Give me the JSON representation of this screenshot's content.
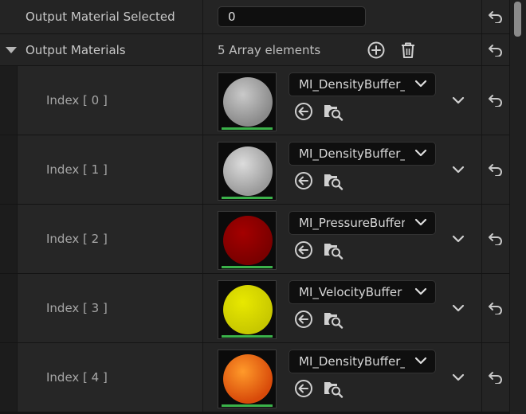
{
  "header": {
    "output_selected_label": "Output Material Selected",
    "output_selected_value": "0",
    "output_materials_label": "Output Materials",
    "array_count_text": "5 Array elements"
  },
  "elements": [
    {
      "index_label": "Index [ 0 ]",
      "material": "MI_DensityBuffer_I",
      "thumb_color": "#8a8a8a",
      "thumb_highlight": "#c9c9c9"
    },
    {
      "index_label": "Index [ 1 ]",
      "material": "MI_DensityBuffer_T",
      "thumb_color": "#9a9a9a",
      "thumb_highlight": "#dcdcdc"
    },
    {
      "index_label": "Index [ 2 ]",
      "material": "MI_PressureBuffer",
      "thumb_color": "#7a0000",
      "thumb_highlight": "#a40000"
    },
    {
      "index_label": "Index [ 3 ]",
      "material": "MI_VelocityBuffer",
      "thumb_color": "#c8c800",
      "thumb_highlight": "#e8e800"
    },
    {
      "index_label": "Index [ 4 ]",
      "material": "MI_DensityBuffer_I",
      "thumb_color": "#d84a0a",
      "thumb_highlight": "#ff9a2a"
    }
  ],
  "icons": {
    "reset": "reset-arrow-icon",
    "add": "plus-circle-icon",
    "delete": "trash-icon",
    "use_selected": "arrow-left-circle-icon",
    "browse": "folder-search-icon",
    "dropdown": "chevron-down-icon"
  },
  "colors": {
    "background": "#242424",
    "input_bg": "#0f0f0f",
    "accent_green": "#3bb24a"
  }
}
